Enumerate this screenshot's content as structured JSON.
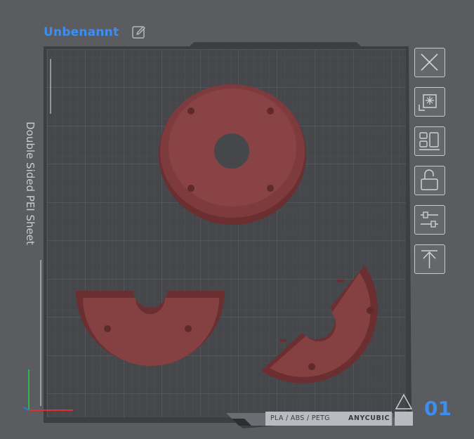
{
  "project": {
    "title": "Unbenannt"
  },
  "plate": {
    "sheet_label": "Double Sided PEI Sheet",
    "material_label": "PLA / ABS / PETG",
    "brand_label": "ANYCUBIC",
    "plate_number": "01"
  },
  "colors": {
    "accent": "#3d8ef0",
    "bed": "#46484c",
    "part": "#7a3a3c"
  },
  "side_toolbar": [
    {
      "name": "close",
      "icon": "close-icon"
    },
    {
      "name": "auto-orient",
      "icon": "auto-orient-icon"
    },
    {
      "name": "arrange",
      "icon": "arrange-icon"
    },
    {
      "name": "lock",
      "icon": "unlock-icon"
    },
    {
      "name": "settings",
      "icon": "sliders-icon"
    },
    {
      "name": "top",
      "icon": "move-to-top-icon"
    }
  ]
}
